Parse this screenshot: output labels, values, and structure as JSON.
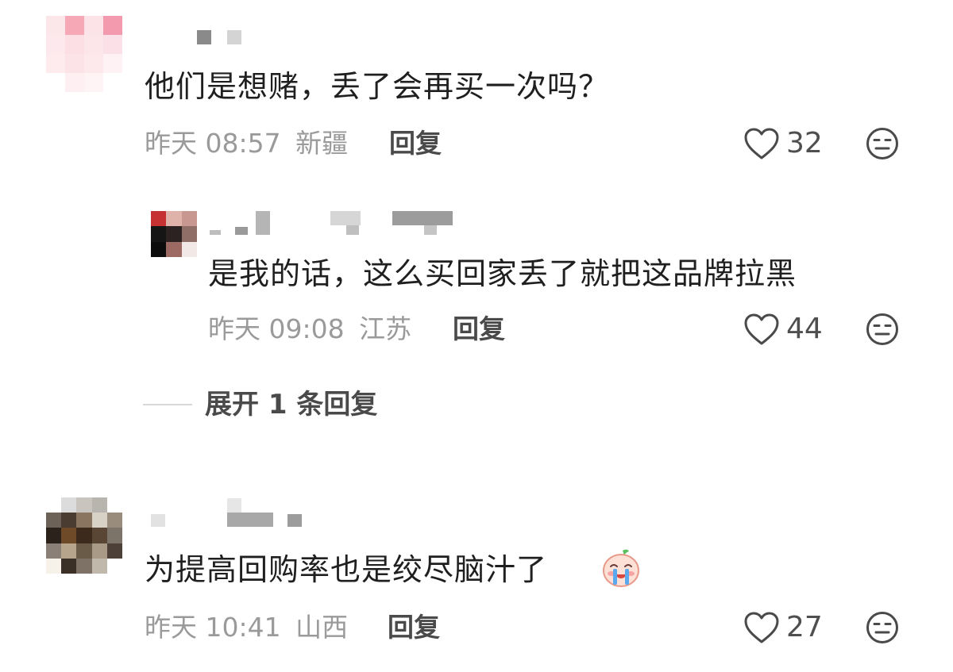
{
  "comments": [
    {
      "text": "他们是想赌，丢了会再买一次吗？",
      "time": "昨天 08:57",
      "location": "新疆",
      "reply_label": "回复",
      "likes": "32"
    },
    {
      "text": "是我的话，这么买回家丢了就把这品牌拉黑",
      "time": "昨天 09:08",
      "location": "江苏",
      "reply_label": "回复",
      "likes": "44"
    },
    {
      "text": "为提高回购率也是绞尽脑汁了",
      "time": "昨天 10:41",
      "location": "山西",
      "reply_label": "回复",
      "likes": "27",
      "sticker": "crying-baby-sticker"
    }
  ],
  "expand_replies": {
    "label": "展开 1 条回复"
  },
  "icons": {
    "like": "heart-outline-icon",
    "dislike": "meh-face-icon"
  },
  "colors": {
    "text": "#1f1f1f",
    "meta": "#9a9a9a",
    "reply": "#4a4a4a",
    "icon": "#4a4a4a"
  }
}
